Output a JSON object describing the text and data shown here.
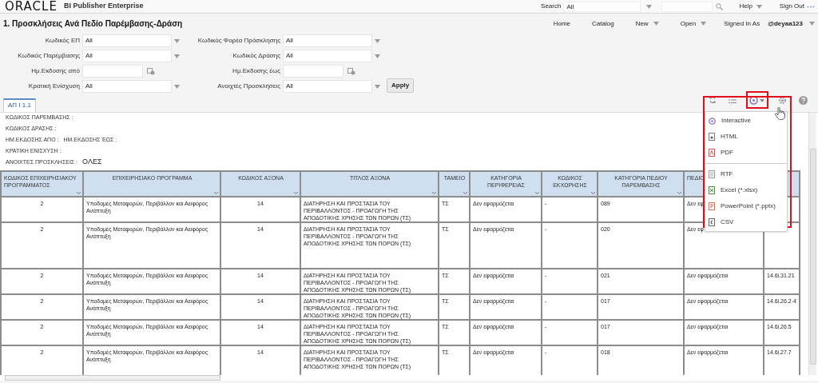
{
  "header": {
    "logo": "ORACLE",
    "product": "BI Publisher Enterprise",
    "search_label": "Search",
    "search_scope": "All",
    "help": "Help",
    "sign_out": "Sign Out"
  },
  "report_title": "1. Προσκλήσεις Ανά Πεδίο Παρέμβασης-Δράση",
  "nav": [
    {
      "label": "Home",
      "dropdown": false
    },
    {
      "label": "Catalog",
      "dropdown": false
    },
    {
      "label": "New",
      "dropdown": true
    },
    {
      "label": "Open",
      "dropdown": true
    }
  ],
  "signed_in_label": "Signed In As",
  "user": "@deyaa123",
  "parameters": [
    {
      "label": "Κωδικός ΕΠ",
      "kind": "select",
      "value": "All"
    },
    {
      "label": "Κωδικός Φορέα Πρόσκλησης",
      "kind": "select",
      "value": "All"
    },
    {
      "label": "Κωδικός Παρέμβασης",
      "kind": "select",
      "value": "All"
    },
    {
      "label": "Κωδικός Δράσης",
      "kind": "select",
      "value": "All"
    },
    {
      "label": "Ημ.Εκδοσης από",
      "kind": "date"
    },
    {
      "label": "Ημ.Εκδοσης έως",
      "kind": "date"
    },
    {
      "label": "Κρατική Ενίσχυση",
      "kind": "select",
      "value": "All"
    },
    {
      "label": "Ανοιχτές Προσκλήσεις",
      "kind": "select",
      "value": "All"
    }
  ],
  "apply": "Apply",
  "tabs": [
    {
      "label": "ΑΠ I 1.1",
      "selected": true
    }
  ],
  "report_lines": [
    [
      {
        "text": "ΚΩΔΙΚΟΣ ΠΑΡΕΜΒΑΣΗΣ :",
        "kind": "label"
      }
    ],
    [
      {
        "text": "ΚΩΔΙΚΟΣ ΔΡΑΣΗΣ :",
        "kind": "label"
      }
    ],
    [
      {
        "text": "ΗΜ.ΕΚΔΟΣΗΣ ΑΠΟ :",
        "kind": "label"
      },
      {
        "text": "ΗΜ.ΕΚΔΟΣΗΣ ΈΩΣ :",
        "kind": "label"
      }
    ],
    [
      {
        "text": "ΚΡΑΤΙΚΗ ΕΝΙΣΧΥΣΗ :",
        "kind": "label"
      }
    ],
    [
      {
        "text": "ΑΝΟΙΧΤΕΣ ΠΡΟΣΚΛΗΣΕΙΣ :",
        "kind": "label"
      },
      {
        "text": "ΟΛΕΣ",
        "kind": "value"
      }
    ]
  ],
  "table": {
    "columns": [
      "ΚΩΔΙΚΟΣ ΕΠΙΧΕΙΡΗΣΙΑΚΟΥ ΠΡΟΓΡΑΜΜΑΤΟΣ",
      "ΕΠΙΧΕΙΡΗΣΙΑΚΟ ΠΡΟΓΡΑΜΜΑ",
      "ΚΩΔΙΚΟΣ ΑΞΟΝΑ",
      "ΤΙΤΛΟΣ ΑΞΟΝΑ",
      "ΤΑΜΕΙΟ",
      "ΚΑΤΗΓΟΡΙΑ ΠΕΡΙΦΕΡΕΙΑΣ",
      "ΚΩΔΙΚΟΣ ΕΚΧΩΡΗΣΗΣ",
      "ΚΑΤΗΓΟΡΙΑ ΠΕΔΙΟΥ ΠΑΡΕΜΒΑΣΗΣ",
      "ΠΕΔΙΟ"
    ],
    "rows": [
      [
        "2",
        "Υποδομές Μεταφορών, Περιβάλλον και Αειφόρος Ανάπτυξη",
        "14",
        "ΔΙΑΤΗΡΗΣΗ ΚΑΙ ΠΡΟΣΤΑΣΙΑ ΤΟΥ ΠΕΡΙΒΑΛΛΟΝΤΟΣ - ΠΡΟΑΓΩΓΗ ΤΗΣ ΑΠΟΔΟΤΙΚΗΣ ΧΡΗΣΗΣ ΤΩΝ ΠΟΡΩΝ (ΤΣ)",
        "ΤΣ",
        "Δεν εφαρμόζεται",
        "-",
        "089",
        "Δεν εφ"
      ],
      [
        "2",
        "Υποδομές Μεταφορών, Περιβάλλον και Αειφόρος Ανάπτυξη",
        "14",
        "ΔΙΑΤΗΡΗΣΗ ΚΑΙ ΠΡΟΣΤΑΣΙΑ ΤΟΥ ΠΕΡΙΒΑΛΛΟΝΤΟΣ - ΠΡΟΑΓΩΓΗ ΤΗΣ ΑΠΟΔΟΤΙΚΗΣ ΧΡΗΣΗΣ ΤΩΝ ΠΟΡΩΝ (ΤΣ)",
        "ΤΣ",
        "Δεν εφαρμόζεται",
        "-",
        "020",
        "Δεν εφ"
      ],
      [
        "2",
        "Υποδομές Μεταφορών, Περιβάλλον και Αειφόρος Ανάπτυξη",
        "14",
        "ΔΙΑΤΗΡΗΣΗ ΚΑΙ ΠΡΟΣΤΑΣΙΑ ΤΟΥ ΠΕΡΙΒΑΛΛΟΝΤΟΣ - ΠΡΟΑΓΩΓΗ ΤΗΣ ΑΠΟΔΟΤΙΚΗΣ ΧΡΗΣΗΣ ΤΩΝ ΠΟΡΩΝ (ΤΣ)",
        "ΤΣ",
        "Δεν εφαρμόζεται",
        "-",
        "021",
        "Δεν εφαρμόζεται",
        "14.6i.31.21"
      ],
      [
        "2",
        "Υποδομές Μεταφορών, Περιβάλλον και Αειφόρος Ανάπτυξη",
        "14",
        "ΔΙΑΤΗΡΗΣΗ ΚΑΙ ΠΡΟΣΤΑΣΙΑ ΤΟΥ ΠΕΡΙΒΑΛΛΟΝΤΟΣ - ΠΡΟΑΓΩΓΗ ΤΗΣ ΑΠΟΔΟΤΙΚΗΣ ΧΡΗΣΗΣ ΤΩΝ ΠΟΡΩΝ (ΤΣ)",
        "ΤΣ",
        "Δεν εφαρμόζεται",
        "-",
        "017",
        "Δεν εφαρμόζεται",
        "14.6i.26.2-4"
      ],
      [
        "2",
        "Υποδομές Μεταφορών, Περιβάλλον και Αειφόρος Ανάπτυξη",
        "14",
        "ΔΙΑΤΗΡΗΣΗ ΚΑΙ ΠΡΟΣΤΑΣΙΑ ΤΟΥ ΠΕΡΙΒΑΛΛΟΝΤΟΣ - ΠΡΟΑΓΩΓΗ ΤΗΣ ΑΠΟΔΟΤΙΚΗΣ ΧΡΗΣΗΣ ΤΩΝ ΠΟΡΩΝ (ΤΣ)",
        "ΤΣ",
        "Δεν εφαρμόζεται",
        "-",
        "017",
        "Δεν εφαρμόζεται",
        "14.6i.26.5"
      ],
      [
        "2",
        "Υποδομές Μεταφορών, Περιβάλλον και Αειφόρος Ανάπτυξη",
        "14",
        "ΔΙΑΤΗΡΗΣΗ ΚΑΙ ΠΡΟΣΤΑΣΙΑ ΤΟΥ ΠΕΡΙΒΑΛΛΟΝΤΟΣ - ΠΡΟΑΓΩΓΗ ΤΗΣ ΑΠΟΔΟΤΙΚΗΣ ΧΡΗΣΗΣ ΤΩΝ ΠΟΡΩΝ (ΤΣ)",
        "ΤΣ",
        "Δεν εφαρμόζεται",
        "-",
        "018",
        "Δεν εφαρμόζεται",
        "14.6i.27.7"
      ]
    ]
  },
  "toolbar": [
    {
      "kind": "refresh",
      "selected": false
    },
    {
      "kind": "list",
      "selected": false
    },
    {
      "kind": "view",
      "selected": true
    },
    {
      "kind": "gear",
      "selected": false
    },
    {
      "kind": "help",
      "selected": false
    }
  ],
  "view_menu": {
    "open": true,
    "items": [
      {
        "label": "Interactive",
        "kind": "interactive",
        "separator_before": false
      },
      {
        "label": "HTML",
        "kind": "html",
        "separator_before": false
      },
      {
        "label": "PDF",
        "kind": "pdf",
        "separator_before": false
      },
      {
        "label": "RTF",
        "kind": "rtf",
        "separator_before": true
      },
      {
        "label": "Excel (*.xlsx)",
        "kind": "excel",
        "separator_before": false
      },
      {
        "label": "PowerPoint (*.pptx)",
        "kind": "ppt",
        "separator_before": false
      },
      {
        "label": "CSV",
        "kind": "csv",
        "separator_before": false
      }
    ]
  }
}
